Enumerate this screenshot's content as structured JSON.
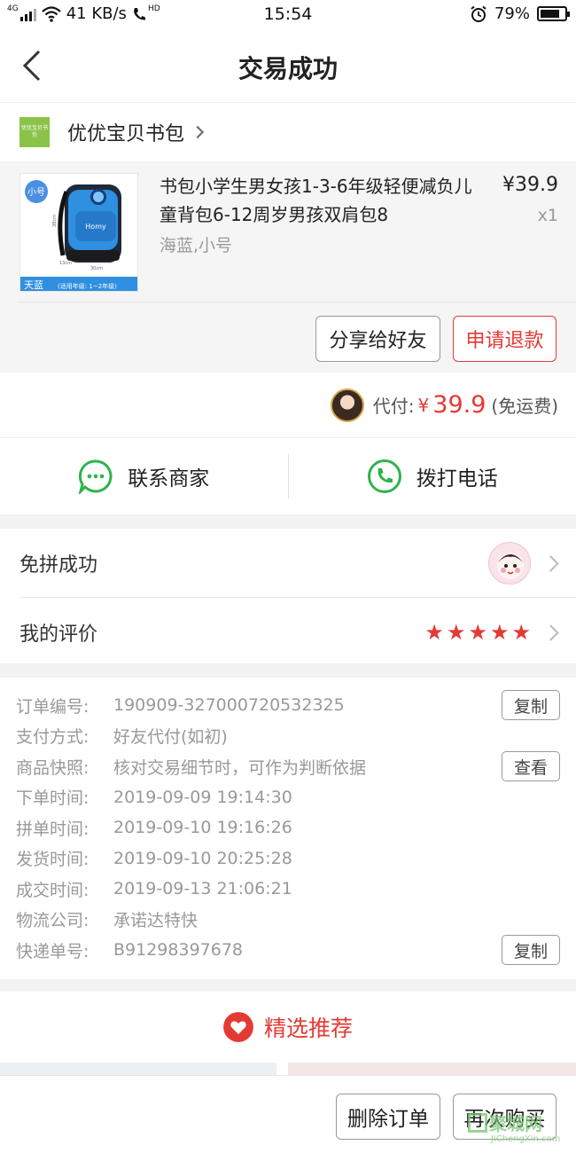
{
  "status_bar": {
    "network_tag": "4G",
    "speed": "41 KB/s",
    "call_tag": "HD",
    "time": "15:54",
    "battery": "79%",
    "battery_level": 0.79
  },
  "nav": {
    "title": "交易成功",
    "back_icon": "chevron-left-icon"
  },
  "shop": {
    "logo_text": "优优宝贝书包",
    "name": "优优宝贝书包"
  },
  "product": {
    "title": "书包小学生男女孩1-3-6年级轻便减负儿童背包6-12周岁男孩双肩包8",
    "spec": "海蓝,小号",
    "price": "¥39.9",
    "qty": "x1",
    "image": {
      "size_tag": "小号",
      "color_tag": "天蓝",
      "grade_tag": "(适用年级: 1~2年级)",
      "dim_w": "30cm",
      "dim_h": "38cm",
      "dim_d": "13cm",
      "brand": "Homy"
    },
    "share_button": "分享给好友",
    "refund_button": "申请退款"
  },
  "payment": {
    "label": "代付:",
    "currency": "¥",
    "amount": "39.9",
    "note": "(免运费)"
  },
  "contact": {
    "merchant_label": "联系商家",
    "phone_label": "拨打电话"
  },
  "group": {
    "label": "免拼成功"
  },
  "review": {
    "label": "我的评价",
    "rating": 5,
    "max_rating": 5
  },
  "order": {
    "rows": [
      {
        "label": "订单编号:",
        "value": "190909-327000720532325",
        "action": "复制"
      },
      {
        "label": "支付方式:",
        "value": "好友代付(如初)"
      },
      {
        "label": "商品快照:",
        "value": "核对交易细节时，可作为判断依据",
        "action": "查看"
      },
      {
        "label": "下单时间:",
        "value": "2019-09-09 19:14:30"
      },
      {
        "label": "拼单时间:",
        "value": "2019-09-10 19:16:26"
      },
      {
        "label": "发货时间:",
        "value": "2019-09-10 20:25:28"
      },
      {
        "label": "成交时间:",
        "value": "2019-09-13 21:06:21"
      },
      {
        "label": "物流公司:",
        "value": "承诺达特快"
      },
      {
        "label": "快递单号:",
        "value": "B91298397678",
        "action": "复制"
      }
    ]
  },
  "recommend": {
    "label": "精选推荐"
  },
  "bottom": {
    "delete_button": "删除订单",
    "rebuy_button": "再次购买"
  },
  "watermark": {
    "main": "聚城网",
    "sub": "JiChengXin.com"
  },
  "colors": {
    "accent_red": "#e53935",
    "green": "#2fb34a",
    "gray_bg": "#f5f5f5"
  }
}
